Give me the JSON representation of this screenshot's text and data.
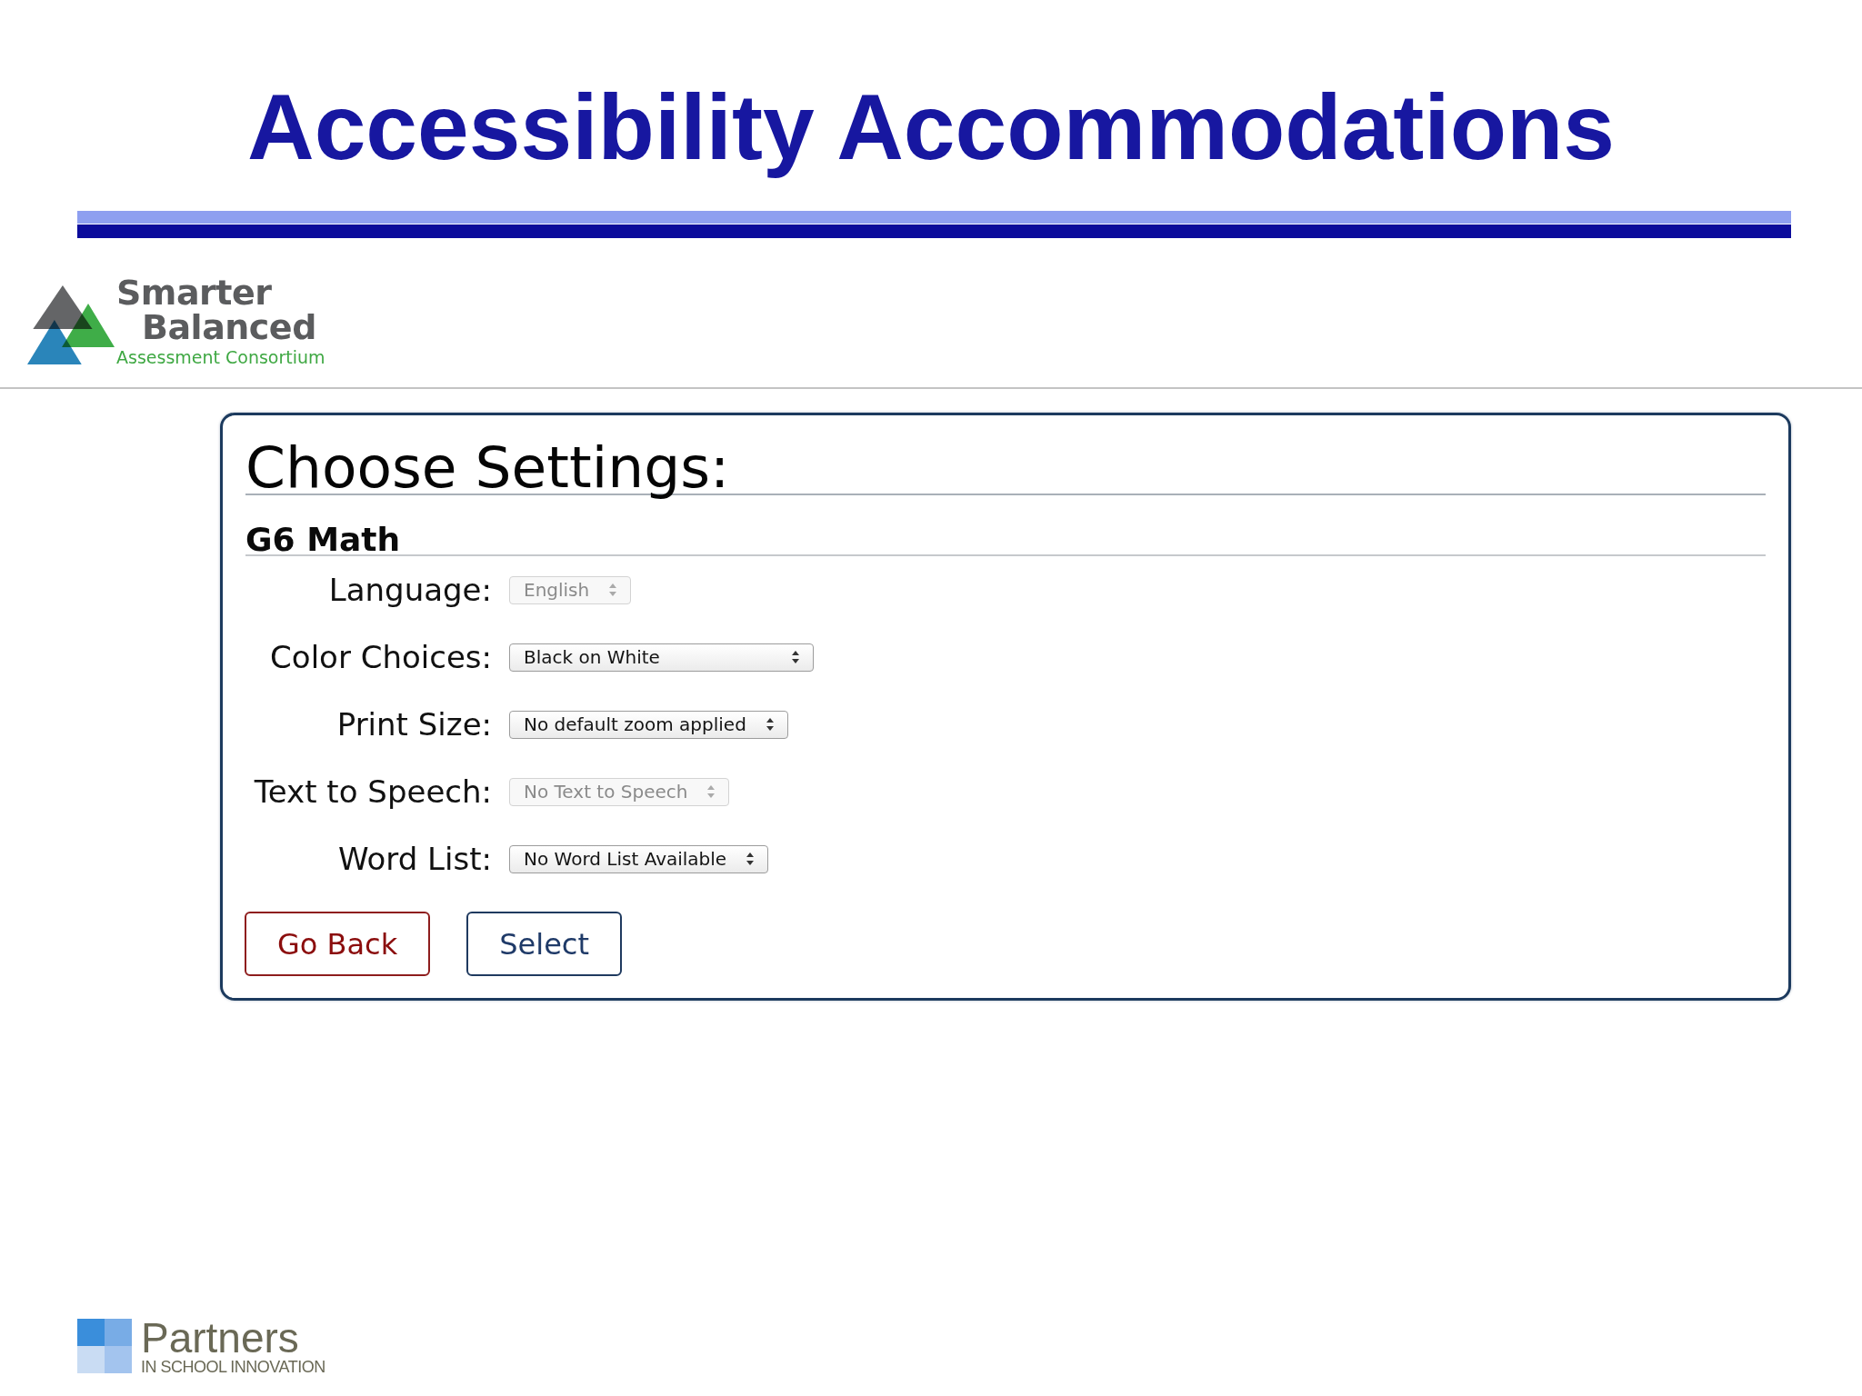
{
  "slide_title": "Accessibility Accommodations",
  "header_logo": {
    "wordmark": [
      "Smarter",
      "Balanced"
    ],
    "tagline": "Assessment Consortium"
  },
  "settings_panel": {
    "heading": "Choose Settings:",
    "test_name": "G6 Math",
    "settings": [
      {
        "label": "Language:",
        "value": "English",
        "disabled": true
      },
      {
        "label": "Color Choices:",
        "value": "Black on White",
        "disabled": false
      },
      {
        "label": "Print Size:",
        "value": "No default zoom applied",
        "disabled": false
      },
      {
        "label": "Text to Speech:",
        "value": "No Text to Speech",
        "disabled": true
      },
      {
        "label": "Word List:",
        "value": "No Word List Available",
        "disabled": false
      }
    ],
    "buttons": [
      {
        "label": "Go Back",
        "kind": "back"
      },
      {
        "label": "Select",
        "kind": "confirm"
      }
    ]
  },
  "footer_logo": {
    "name": "Partners",
    "subtitle": "IN SCHOOL INNOVATION"
  }
}
